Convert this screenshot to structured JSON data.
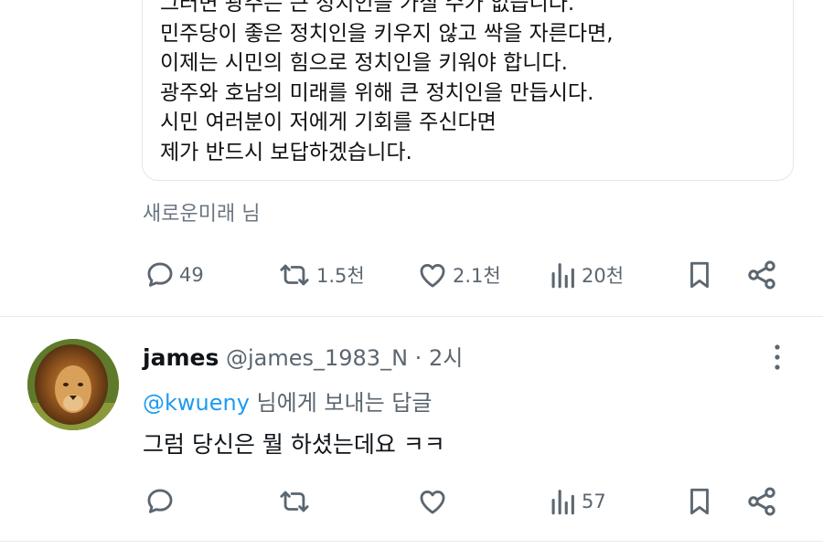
{
  "quoted_post": {
    "lines": [
      "그러면 광주는 큰 정치인을 가질 수가 없습니다.",
      "민주당이 좋은 정치인을 키우지 않고 싹을 자른다면,",
      "이제는 시민의 힘으로 정치인을 키워야 합니다.",
      "광주와 호남의 미래를 위해 큰 정치인을 만듭시다.",
      "시민 여러분이 저에게 기회를 주신다면",
      "제가 반드시 보답하겠습니다."
    ],
    "source": "새로운미래 님"
  },
  "main_actions": {
    "replies": "49",
    "reposts": "1.5천",
    "likes": "2.1천",
    "views": "20천"
  },
  "reply": {
    "author": "james",
    "handle": "@james_1983_N",
    "separator": "·",
    "time": "2시",
    "replying_to_mention": "@kwueny",
    "replying_to_suffix": " 님에게 보내는 답글",
    "text": "그럼 당신은 뭘 하셨는데요 ㅋㅋ",
    "actions": {
      "views": "57"
    }
  },
  "icons": {
    "reply": "reply-bubble-icon",
    "repost": "repost-icon",
    "like": "heart-icon",
    "views": "views-bar-icon",
    "bookmark": "bookmark-icon",
    "share": "share-icon",
    "more": "more-vertical-icon"
  },
  "colors": {
    "accent": "#1d9bf0",
    "secondary_text": "#5b6670",
    "divider": "#e6e9ec"
  }
}
